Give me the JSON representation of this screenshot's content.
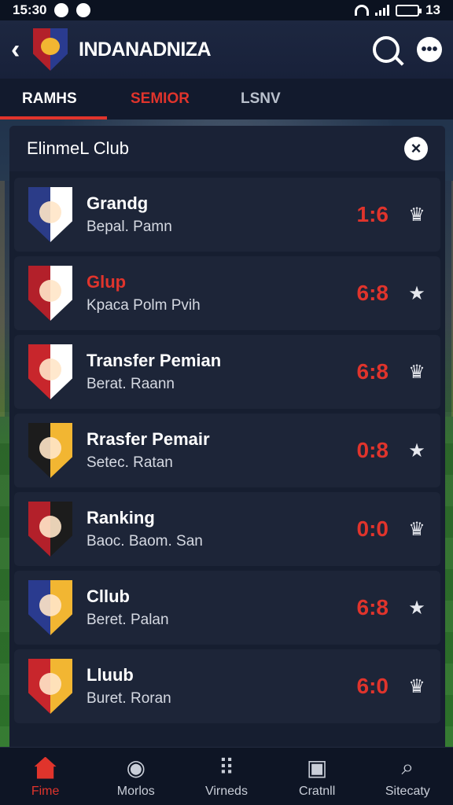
{
  "status_bar": {
    "time": "15:30",
    "battery_label": "13"
  },
  "header": {
    "title": "INDANADNIZA"
  },
  "tabs": [
    {
      "label": "RAMHS"
    },
    {
      "label": "SEMIOR"
    },
    {
      "label": "LSNV"
    }
  ],
  "panel": {
    "title": "ElinmeL Club",
    "rows": [
      {
        "title": "Grandg",
        "subtitle": "Bepal. Pamn",
        "score": "1:6",
        "crest_colors": [
          "#2b3c88",
          "#ffffff"
        ],
        "fav": "badge"
      },
      {
        "title": "Glup",
        "subtitle": "Kpaca Polm Pvih",
        "score": "6:8",
        "crest_colors": [
          "#b3202a",
          "#ffffff"
        ],
        "fav": "star",
        "title_color": "#e0342c"
      },
      {
        "title": "Transfer Pemian",
        "subtitle": "Berat. Raann",
        "score": "6:8",
        "crest_colors": [
          "#c8262c",
          "#ffffff"
        ],
        "fav": "badge"
      },
      {
        "title": "Rrasfer Pemair",
        "subtitle": "Setec. Ratan",
        "score": "0:8",
        "crest_colors": [
          "#1c1c1c",
          "#f2b632"
        ],
        "fav": "star"
      },
      {
        "title": "Ranking",
        "subtitle": "Baoc. Baom. San",
        "score": "0:0",
        "crest_colors": [
          "#b3202a",
          "#1c1c1c"
        ],
        "fav": "badge"
      },
      {
        "title": "Cllub",
        "subtitle": "Beret. Palan",
        "score": "6:8",
        "crest_colors": [
          "#2a3b8f",
          "#f2b632"
        ],
        "fav": "star"
      },
      {
        "title": "Lluub",
        "subtitle": "Buret. Roran",
        "score": "6:0",
        "crest_colors": [
          "#c8262c",
          "#f2b632"
        ],
        "fav": "badge"
      }
    ]
  },
  "bottom_nav": [
    {
      "label": "Fime",
      "icon": "home-icon",
      "active": true
    },
    {
      "label": "Morlos",
      "icon": "ball-icon",
      "active": false
    },
    {
      "label": "Virneds",
      "icon": "grid-icon",
      "active": false
    },
    {
      "label": "Cratnll",
      "icon": "clipboard-icon",
      "active": false
    },
    {
      "label": "Sitecaty",
      "icon": "search-icon",
      "active": false
    }
  ],
  "colors": {
    "accent": "#e0342c",
    "panel": "#161e30",
    "row": "#1d2538"
  }
}
